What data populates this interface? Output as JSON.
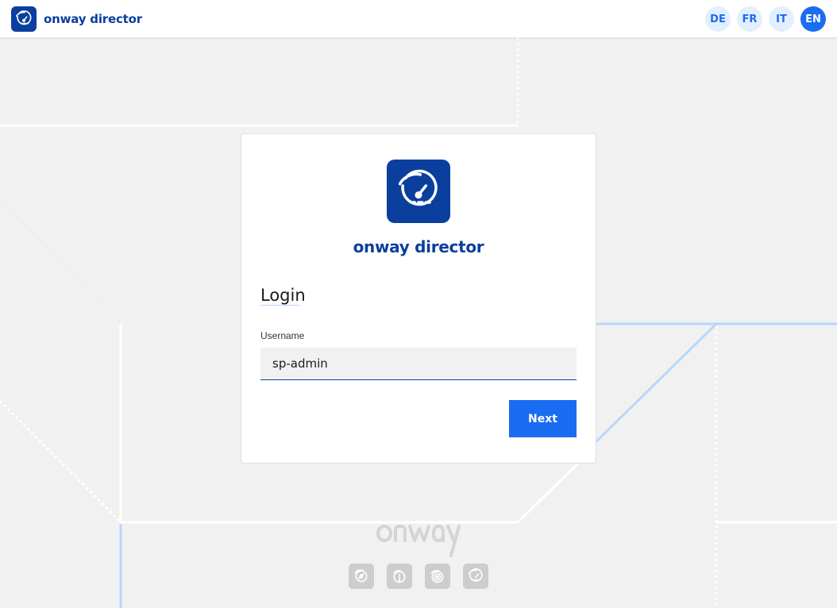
{
  "header": {
    "app_name": "onway director",
    "languages": [
      {
        "code": "DE",
        "active": false
      },
      {
        "code": "FR",
        "active": false
      },
      {
        "code": "IT",
        "active": false
      },
      {
        "code": "EN",
        "active": true
      }
    ]
  },
  "login": {
    "brand": "onway director",
    "title": "Login",
    "username_label": "Username",
    "username_value": "sp-admin",
    "next_label": "Next"
  },
  "footer": {
    "wordmark": "onway",
    "app_icons": [
      "compass-app-icon",
      "info-app-icon",
      "signal-app-icon",
      "dashboard-app-icon"
    ]
  },
  "colors": {
    "brand": "#0a3f9e",
    "accent": "#1a6cf0",
    "background": "#f1f1f1",
    "lang_inactive_bg": "#e3efff"
  }
}
